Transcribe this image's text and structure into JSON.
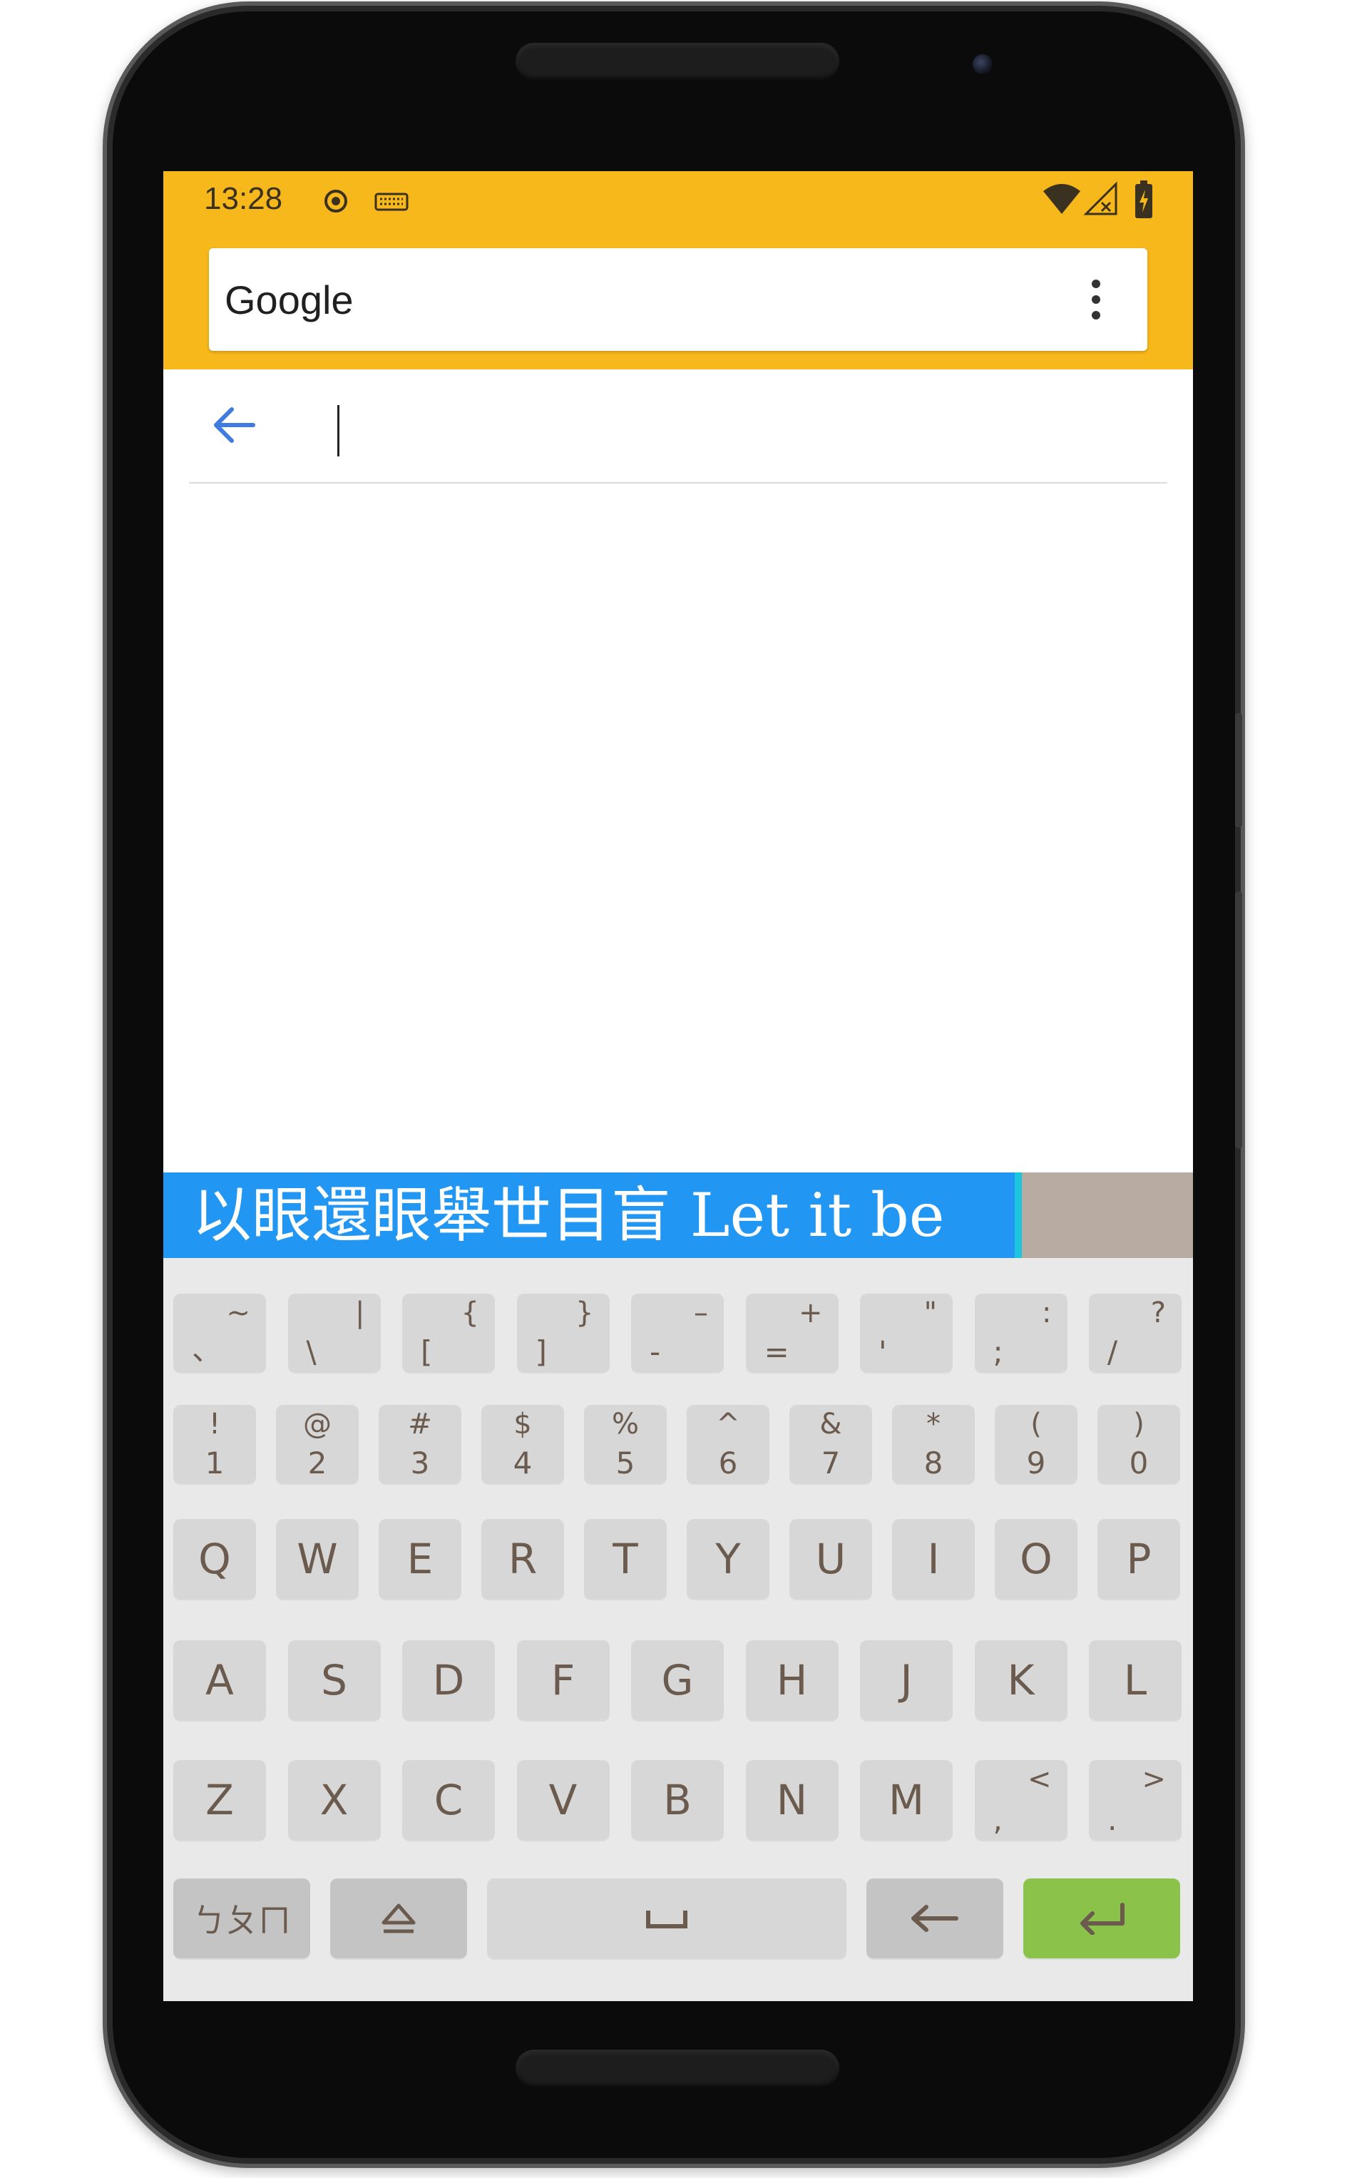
{
  "status": {
    "time": "13:28"
  },
  "appbar": {
    "title": "Google",
    "menu_icon": "more-vert-icon"
  },
  "search": {
    "value": "",
    "placeholder": ""
  },
  "candidate": {
    "text": "以眼還眼舉世目盲 Let it be"
  },
  "keyboard": {
    "row1": [
      {
        "top": "~",
        "bot": "、"
      },
      {
        "top": "|",
        "bot": "\\"
      },
      {
        "top": "{",
        "bot": "["
      },
      {
        "top": "}",
        "bot": "]"
      },
      {
        "top": "–",
        "bot": "-"
      },
      {
        "top": "+",
        "bot": "="
      },
      {
        "top": "\"",
        "bot": "'"
      },
      {
        "top": ":",
        "bot": ";"
      },
      {
        "top": "?",
        "bot": "/"
      }
    ],
    "row2": [
      {
        "top": "!",
        "bot": "1"
      },
      {
        "top": "@",
        "bot": "2"
      },
      {
        "top": "#",
        "bot": "3"
      },
      {
        "top": "$",
        "bot": "4"
      },
      {
        "top": "%",
        "bot": "5"
      },
      {
        "top": "^",
        "bot": "6"
      },
      {
        "top": "&",
        "bot": "7"
      },
      {
        "top": "*",
        "bot": "8"
      },
      {
        "top": "(",
        "bot": "9"
      },
      {
        "top": ")",
        "bot": "0"
      }
    ],
    "row3": [
      "Q",
      "W",
      "E",
      "R",
      "T",
      "Y",
      "U",
      "I",
      "O",
      "P"
    ],
    "row4": [
      "A",
      "S",
      "D",
      "F",
      "G",
      "H",
      "J",
      "K",
      "L"
    ],
    "row5": [
      "Z",
      "X",
      "C",
      "V",
      "B",
      "N",
      "M",
      {
        "top": "<",
        "bot": ","
      },
      {
        "top": ">",
        "bot": "."
      }
    ],
    "bottom": {
      "lang_label": "ㄅㄆㄇ",
      "shift_icon": "shift-icon",
      "space_icon": "space-icon",
      "backspace_icon": "backspace-icon",
      "enter_icon": "enter-icon"
    }
  },
  "colors": {
    "statusbar": "#f7b81c",
    "candidate_bg": "#2196f3",
    "enter_key": "#8bc34a",
    "key_text": "#6b5a4e"
  }
}
